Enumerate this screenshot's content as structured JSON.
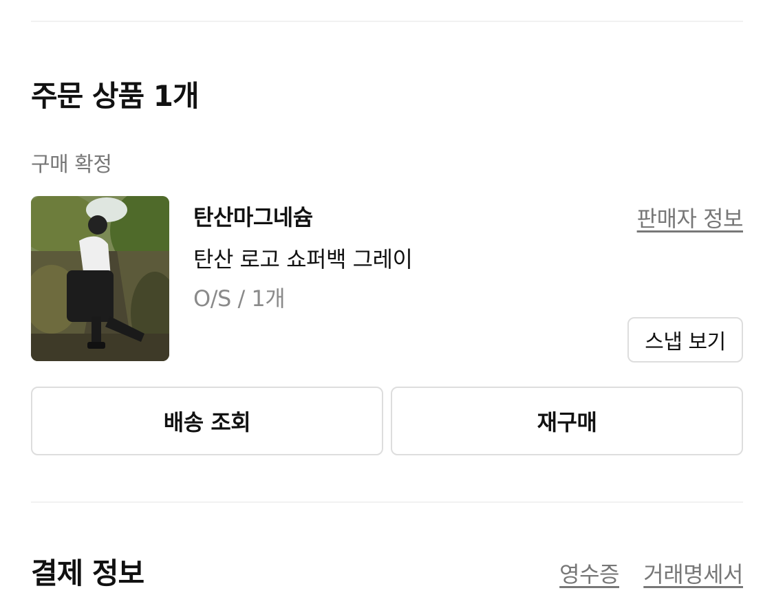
{
  "order_section": {
    "title": "주문 상품 1개",
    "status": "구매 확정"
  },
  "item": {
    "brand": "탄산마그네슘",
    "product_name": "탄산 로고 쇼퍼백 그레이",
    "option": "O/S / 1개",
    "seller_info_label": "판매자 정보",
    "snap_label": "스냅 보기"
  },
  "actions": {
    "track_label": "배송 조회",
    "rebuy_label": "재구매"
  },
  "payment_section": {
    "title": "결제 정보",
    "receipt_label": "영수증",
    "statement_label": "거래명세서"
  }
}
